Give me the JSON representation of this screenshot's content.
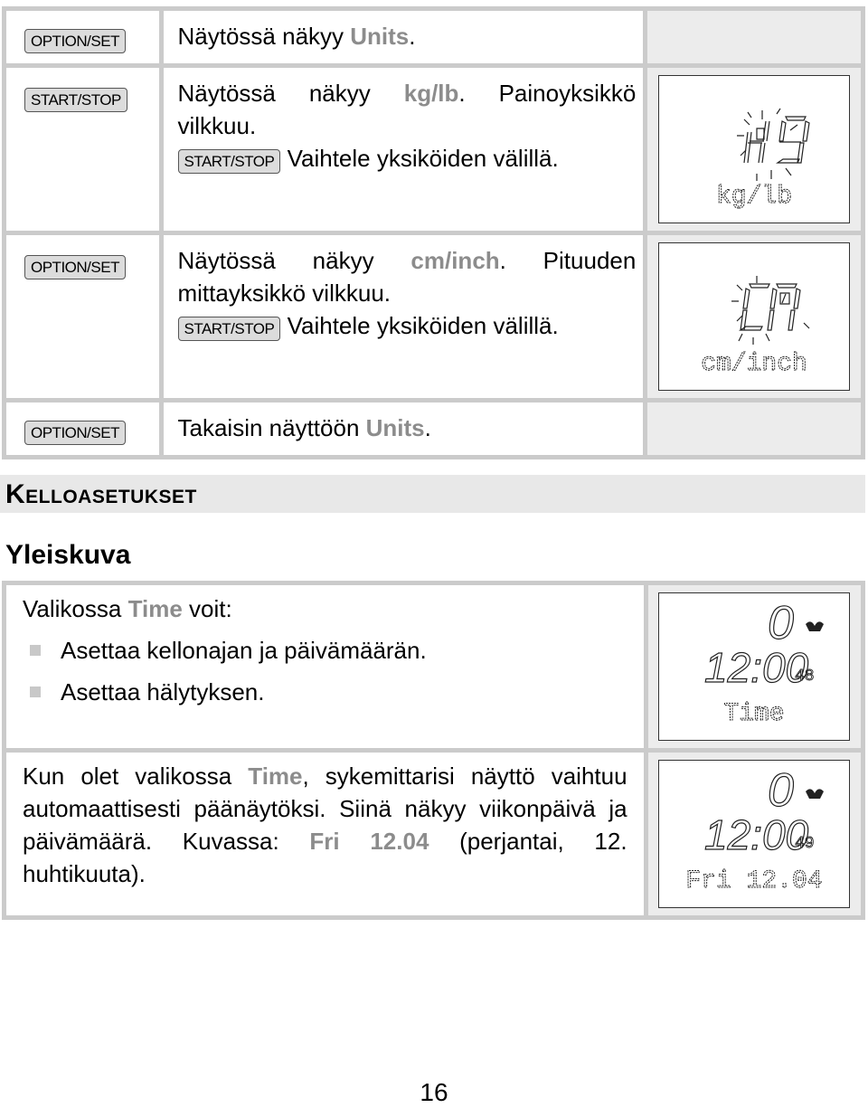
{
  "steps": [
    {
      "key": "OPTION/SET",
      "text_before": "Näytössä näkyy ",
      "highlight": "Units",
      "text_after": ".",
      "sub_key": null,
      "sub_text": null,
      "display": null
    },
    {
      "key": "START/STOP",
      "text_before": "Näytössä näkyy ",
      "highlight": "kg/lb",
      "text_after": ". Painoyksikkö vilkkuu.",
      "sub_key": "START/STOP",
      "sub_text": "Vaihtele yksiköiden välillä.",
      "display": {
        "digits": "kg",
        "label": "kg/lb",
        "blinking": true
      }
    },
    {
      "key": "OPTION/SET",
      "text_before": "Näytössä näkyy ",
      "highlight": "cm/inch",
      "text_after": ". Pituuden mittayksikkö vilkkuu.",
      "sub_key": "START/STOP",
      "sub_text": "Vaihtele yksiköiden välillä.",
      "display": {
        "digits": "cm",
        "label": "cm/inch",
        "blinking": true
      }
    },
    {
      "key": "OPTION/SET",
      "text_before": "Takaisin näyttöön ",
      "highlight": "Units",
      "text_after": ".",
      "sub_key": null,
      "sub_text": null,
      "display": null
    }
  ],
  "section_title": "Kelloasetukset",
  "subsection_title": "Yleiskuva",
  "overview": {
    "intro_before": "Valikossa ",
    "intro_highlight": "Time",
    "intro_after": " voit:",
    "bullets": [
      "Asettaa kellonajan ja päivämäärän.",
      "Asettaa hälytyksen."
    ],
    "para_before": "Kun olet valikossa ",
    "para_highlight": "Time",
    "para_mid": ", sykemittarisi näyttö vaihtuu automaattisesti päänäytöksi. Siinä näkyy viikonpäivä ja päivämäärä. Kuvassa: ",
    "para_highlight2": "Fri 12.04",
    "para_after": " (perjantai, 12. huhtikuuta).",
    "display1": {
      "top": "0",
      "time": "12:00",
      "seconds": "48",
      "label": "Time",
      "icon": "heart-wings-icon"
    },
    "display2": {
      "top": "0",
      "time": "12:00",
      "seconds": "49",
      "label": "Fri 12.04",
      "icon": "heart-wings-icon"
    }
  },
  "page_number": "16"
}
